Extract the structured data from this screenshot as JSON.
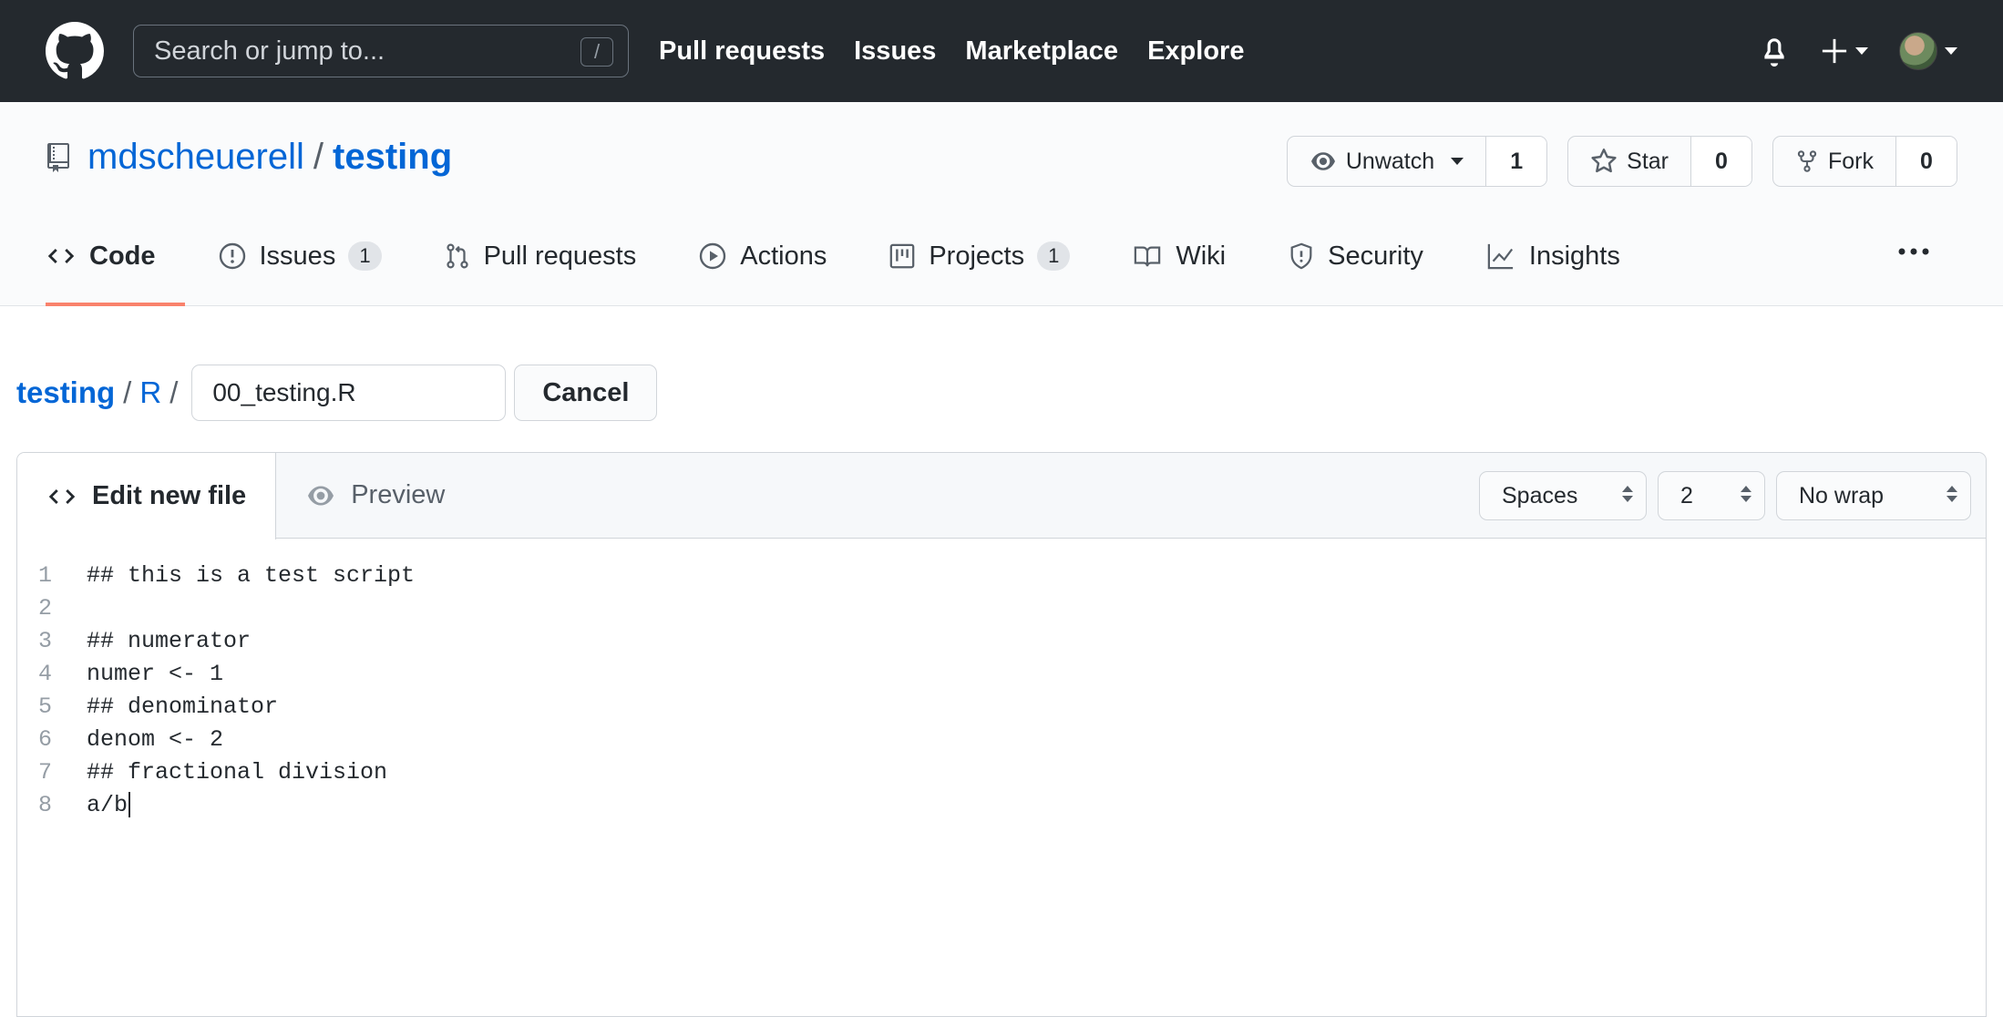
{
  "header": {
    "search_placeholder": "Search or jump to...",
    "search_shortcut": "/",
    "nav": [
      "Pull requests",
      "Issues",
      "Marketplace",
      "Explore"
    ]
  },
  "repo": {
    "owner": "mdscheuerell",
    "name": "testing",
    "separator": "/",
    "watch_label": "Unwatch",
    "watch_count": "1",
    "star_label": "Star",
    "star_count": "0",
    "fork_label": "Fork",
    "fork_count": "0"
  },
  "tabs": [
    {
      "label": "Code",
      "icon": "code-icon"
    },
    {
      "label": "Issues",
      "counter": "1",
      "icon": "issue-icon"
    },
    {
      "label": "Pull requests",
      "icon": "pull-request-icon"
    },
    {
      "label": "Actions",
      "icon": "play-icon"
    },
    {
      "label": "Projects",
      "counter": "1",
      "icon": "project-icon"
    },
    {
      "label": "Wiki",
      "icon": "book-icon"
    },
    {
      "label": "Security",
      "icon": "shield-icon"
    },
    {
      "label": "Insights",
      "icon": "graph-icon"
    }
  ],
  "path": {
    "root": "testing",
    "folder": "R",
    "separator": "/",
    "filename": "00_testing.R",
    "cancel_label": "Cancel"
  },
  "editor": {
    "edit_tab": "Edit new file",
    "preview_tab": "Preview",
    "indent_mode": "Spaces",
    "indent_size": "2",
    "wrap_mode": "No wrap",
    "lines": [
      {
        "n": "1",
        "text": "## this is a test script"
      },
      {
        "n": "2",
        "text": ""
      },
      {
        "n": "3",
        "text": "## numerator"
      },
      {
        "n": "4",
        "text": "numer <- 1"
      },
      {
        "n": "5",
        "text": "## denominator"
      },
      {
        "n": "6",
        "text": "denom <- 2"
      },
      {
        "n": "7",
        "text": "## fractional division"
      },
      {
        "n": "8",
        "text": "a/b"
      }
    ]
  },
  "colors": {
    "header_bg": "#24292e",
    "link": "#0366d6",
    "tab_underline": "#f9826c"
  }
}
